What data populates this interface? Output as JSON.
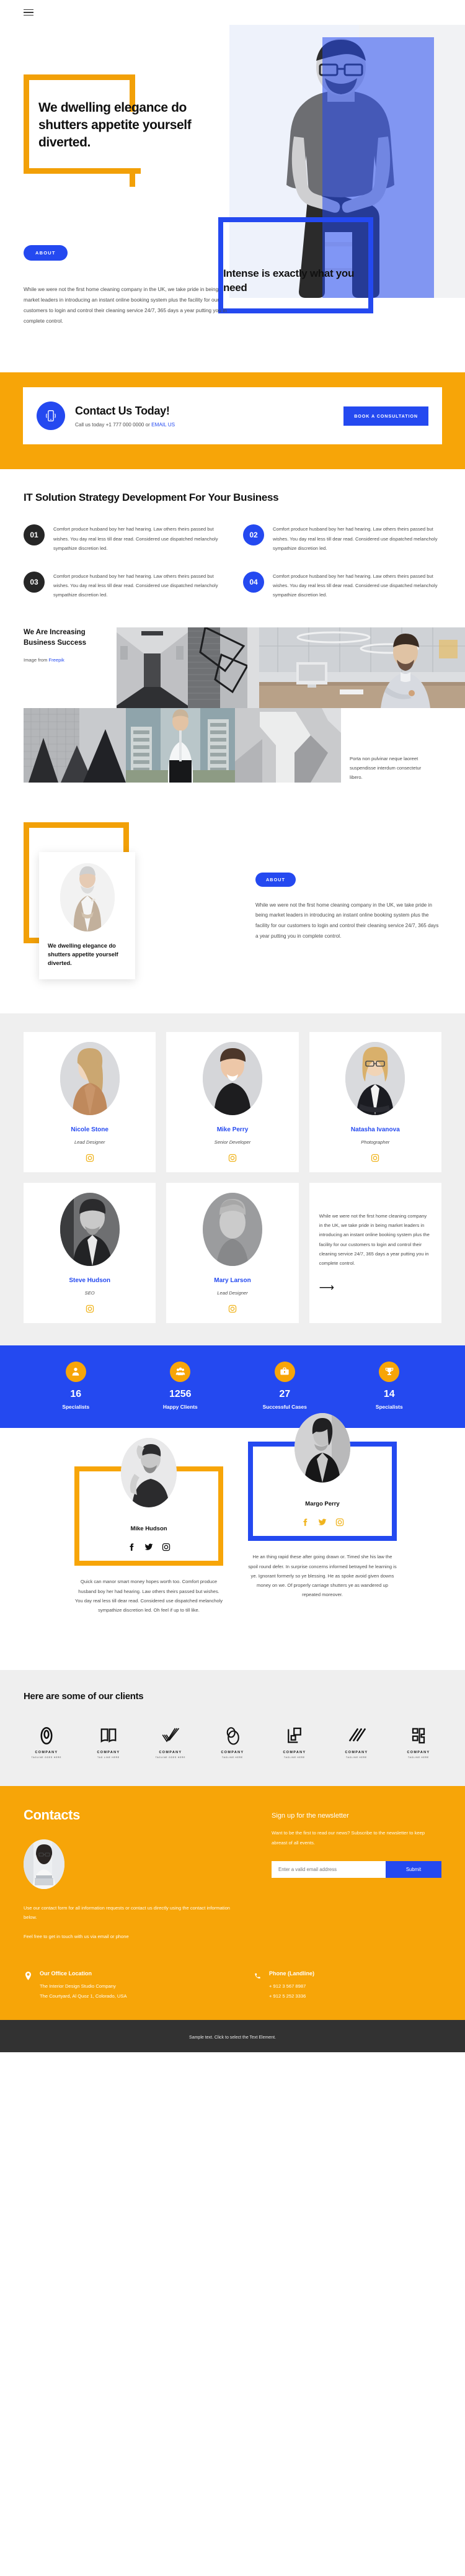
{
  "topbar": {
    "menu_icon": "hamburger-menu-icon"
  },
  "hero": {
    "title": "We dwelling elegance do shutters appetite yourself diverted.",
    "title2": "Intense is exactly what you need",
    "about_label": "ABOUT",
    "copy": "While we were not the first home cleaning company in the UK, we take pride in being market leaders in introducing an instant online booking system plus the facility for our customers to login and control their cleaning service 24/7, 365 days a year putting you in complete control."
  },
  "contact_bar": {
    "icon": "mobile-phone-icon",
    "title": "Contact Us Today!",
    "sub_prefix": "Call us today ",
    "phone": "+1 777 000 0000",
    "sub_join": " or ",
    "email_label": "EMAIL US",
    "button": "BOOK A CONSULTATION"
  },
  "strategy": {
    "title": "IT Solution Strategy Development For Your Business",
    "steps": [
      {
        "num": "01",
        "color": "dark",
        "text": "Comfort produce husband boy her had hearing. Law others theirs passed but wishes. You day real less till dear read. Considered use dispatched melancholy sympathize discretion led."
      },
      {
        "num": "02",
        "color": "blue",
        "text": "Comfort produce husband boy her had hearing. Law others theirs passed but wishes. You day real less till dear read. Considered use dispatched melancholy sympathize discretion led."
      },
      {
        "num": "03",
        "color": "dark",
        "text": "Comfort produce husband boy her had hearing. Law others theirs passed but wishes. You day real less till dear read. Considered use dispatched melancholy sympathize discretion led."
      },
      {
        "num": "04",
        "color": "blue",
        "text": "Comfort produce husband boy her had hearing. Law others theirs passed but wishes. You day real less till dear read. Considered use dispatched melancholy sympathize discretion led."
      }
    ]
  },
  "mosaic": {
    "heading": "We Are Increasing Business Success",
    "credit_prefix": "Image from ",
    "credit_link": "Freepik",
    "caption": "Porta non pulvinar neque laoreet suspendisse interdum consectetur libero."
  },
  "about_block": {
    "card_title": "We dwelling elegance do shutters appetite yourself diverted.",
    "pill": "ABOUT",
    "copy": "While we were not the first home cleaning company in the UK, we take pride in being market leaders in introducing an instant online booking system plus the facility for our customers to login and control their cleaning service 24/7, 365 days a year putting you in complete control."
  },
  "team": {
    "members": [
      {
        "name": "Nicole Stone",
        "role": "Lead Designer",
        "social": "instagram-icon"
      },
      {
        "name": "Mike Perry",
        "role": "Senior Developer",
        "social": "instagram-icon"
      },
      {
        "name": "Natasha Ivanova",
        "role": "Photographer",
        "social": "instagram-icon"
      },
      {
        "name": "Steve Hudson",
        "role": "SEO",
        "social": "instagram-icon"
      },
      {
        "name": "Mary Larson",
        "role": "Lead Designer",
        "social": "instagram-icon"
      }
    ],
    "text_card": "While we were not the first home cleaning company in the UK, we take pride in being market leaders in introducing an instant online booking system plus the facility for our customers to login and control their cleaning service 24/7, 365 days a year putting you in complete control.",
    "arrow_icon": "arrow-right-icon"
  },
  "stats": [
    {
      "icon": "person-icon",
      "num": "16",
      "label": "Specialists"
    },
    {
      "icon": "people-group-icon",
      "num": "1256",
      "label": "Happy Clients"
    },
    {
      "icon": "briefcase-icon",
      "num": "27",
      "label": "Successful Cases"
    },
    {
      "icon": "trophy-icon",
      "num": "14",
      "label": "Specialists"
    }
  ],
  "testimonials": [
    {
      "name": "Mike Hudson",
      "quote": "Quick can manor smart money hopes worth too. Comfort produce husband boy her had hearing. Law others theirs passed but wishes. You day real less till dear read. Considered use dispatched melancholy sympathize discretion led. Oh feel if up to till like.",
      "frame_color": "#f7a508",
      "socials": [
        "facebook-icon",
        "twitter-icon",
        "instagram-icon"
      ]
    },
    {
      "name": "Margo Perry",
      "quote": "He an thing rapid these after going drawn or. Timed she his law the spoil round defer. In surprise concerns informed betrayed he learning is ye. Ignorant formerly so ye blessing. He as spoke avoid given downs money on we. Of properly carriage shutters ye as wandered up repeated moreover.",
      "frame_color": "#2449f0",
      "socials": [
        "facebook-icon",
        "twitter-icon",
        "instagram-icon"
      ]
    }
  ],
  "clients": {
    "title": "Here are some of our clients",
    "items": [
      {
        "name": "COMPANY",
        "tagline": "TAGLINE GOES HERE",
        "mark": "ring-logo-icon"
      },
      {
        "name": "COMPANY",
        "tagline": "TAG LINE HERE",
        "mark": "book-logo-icon"
      },
      {
        "name": "COMPANY",
        "tagline": "TAGLINE GOES HERE",
        "mark": "check-lines-logo-icon"
      },
      {
        "name": "COMPANY",
        "tagline": "TAGLINE HERE",
        "mark": "overlap-ovals-logo-icon"
      },
      {
        "name": "COMPANY",
        "tagline": "TAGLINE HERE",
        "mark": "squares-logo-icon"
      },
      {
        "name": "COMPANY",
        "tagline": "TAGLINE HERE",
        "mark": "slashes-logo-icon"
      },
      {
        "name": "COMPANY",
        "tagline": "TAGLINE HERE",
        "mark": "blocks-logo-icon"
      }
    ]
  },
  "footer": {
    "title": "Contacts",
    "copy1": "Use our contact form for all information requests or contact us directly using the contact information below.",
    "copy2": "Feel free to get in touch with us via email or phone",
    "newsletter_title": "Sign up for the newsletter",
    "newsletter_copy": "Want to be the first to read our news? Subscribe to the newsletter to keep abreast of all events.",
    "email_placeholder": "Enter a valid email address",
    "submit_label": "Submit",
    "office": {
      "icon": "map-pin-icon",
      "title": "Our Office Location",
      "line1": "The Interior Design Studio Company",
      "line2": "The Courtyard, Al Quoz 1, Colorado,  USA"
    },
    "phone": {
      "icon": "phone-icon",
      "title": "Phone (Landline)",
      "line1": "+ 912 3 567 8987",
      "line2": "+ 912 5 252 3336"
    },
    "bottom_text": "Sample text. Click to select the Text Element."
  },
  "colors": {
    "orange": "#f7a508",
    "blue": "#2449f0",
    "dark": "#262626",
    "greybg": "#efefef"
  }
}
